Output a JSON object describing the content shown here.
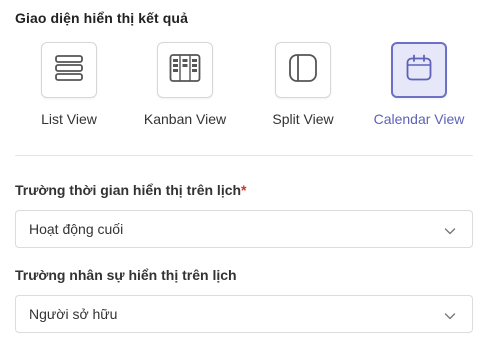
{
  "display_section": {
    "title": "Giao diện hiển thị kết quả",
    "views": [
      {
        "label": "List View",
        "icon": "list-icon",
        "selected": false
      },
      {
        "label": "Kanban View",
        "icon": "kanban-icon",
        "selected": false
      },
      {
        "label": "Split View",
        "icon": "split-view-icon",
        "selected": false
      },
      {
        "label": "Calendar View",
        "icon": "calendar-icon",
        "selected": true
      }
    ]
  },
  "time_field": {
    "label": "Trường thời gian hiển thị trên lịch",
    "required_mark": "*",
    "value": "Hoạt động cuối",
    "icon": "chevron-down-icon"
  },
  "person_field": {
    "label": "Trường nhân sự hiển thị trên lịch",
    "value": "Người sở hữu",
    "icon": "chevron-down-icon"
  },
  "colors": {
    "accent": "#6c70c6",
    "accent_bg": "#e6e7f8",
    "accent_text": "#5d62b8",
    "required": "#d23030"
  }
}
